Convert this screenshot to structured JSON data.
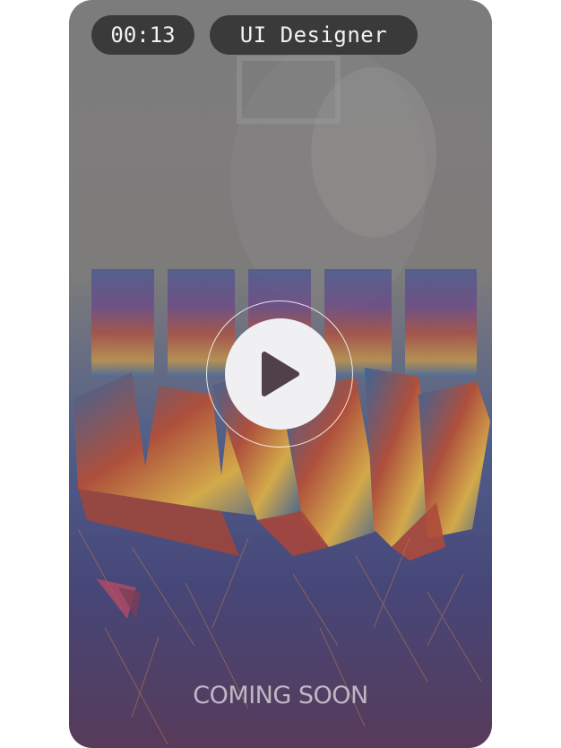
{
  "player": {
    "elapsed_time": "00:13",
    "video_title": "UI Designer",
    "poster_tagline": "COMING SOON",
    "play_icon": "play-icon"
  },
  "colors": {
    "pill_bg": "#3a3a3a",
    "pill_text": "#f2f2f2",
    "play_button_bg": "#f0f0f2",
    "play_glyph": "#514048"
  }
}
